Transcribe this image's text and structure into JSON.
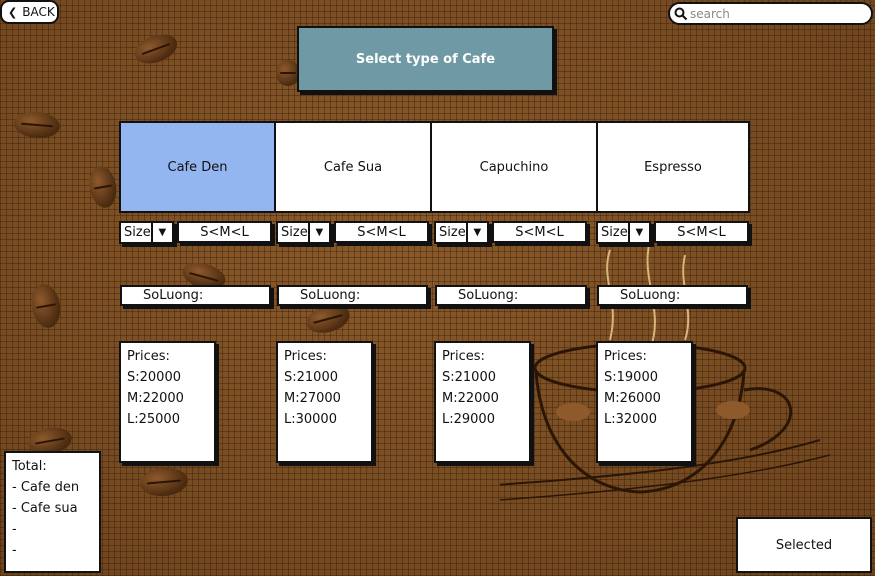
{
  "header": {
    "back_label": "BACK",
    "search_placeholder": "search"
  },
  "title": "Select type of Cafe",
  "cafes": [
    {
      "name": "Cafe Den",
      "selected": true,
      "size_label": "Size",
      "size_range": "S<M<L",
      "qty_label": "SoLuong:",
      "prices_title": "Prices:",
      "prices": [
        "S:20000",
        "M:22000",
        "L:25000"
      ]
    },
    {
      "name": "Cafe Sua",
      "selected": false,
      "size_label": "Size",
      "size_range": "S<M<L",
      "qty_label": "SoLuong:",
      "prices_title": "Prices:",
      "prices": [
        "S:21000",
        "M:27000",
        "L:30000"
      ]
    },
    {
      "name": "Capuchino",
      "selected": false,
      "size_label": "Size",
      "size_range": "S<M<L",
      "qty_label": "SoLuong:",
      "prices_title": "Prices:",
      "prices": [
        "S:21000",
        "M:22000",
        "L:29000"
      ]
    },
    {
      "name": "Espresso",
      "selected": false,
      "size_label": "Size",
      "size_range": "S<M<L",
      "qty_label": "SoLuong:",
      "prices_title": "Prices:",
      "prices": [
        "S:19000",
        "M:26000",
        "L:32000"
      ]
    }
  ],
  "total": {
    "title": "Total:",
    "items": [
      "- Cafe den",
      "- Cafe sua",
      "-",
      "-"
    ]
  },
  "selected_label": "Selected",
  "colors": {
    "selected_card": "#94b6f0",
    "title_box": "#6f9aa5",
    "background": "#7a4d22"
  }
}
